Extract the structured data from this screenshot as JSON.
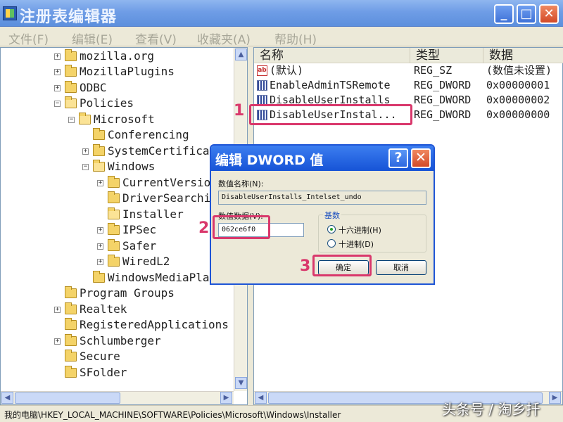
{
  "window": {
    "title": "注册表编辑器",
    "minimize": "_",
    "maximize": "□",
    "close": "✕"
  },
  "menu": [
    "文件(F)",
    "编辑(E)",
    "查看(V)",
    "收藏夹(A)",
    "帮助(H)"
  ],
  "tree": {
    "items": [
      {
        "label": "mozilla.org",
        "expander": "+"
      },
      {
        "label": "MozillaPlugins",
        "expander": "+"
      },
      {
        "label": "ODBC",
        "expander": "+"
      },
      {
        "label": "Policies",
        "expander": "−"
      },
      {
        "label": "Microsoft",
        "expander": "−"
      },
      {
        "label": "Conferencing",
        "expander": ""
      },
      {
        "label": "SystemCertificates",
        "expander": "+"
      },
      {
        "label": "Windows",
        "expander": "−"
      },
      {
        "label": "CurrentVersion",
        "expander": "+"
      },
      {
        "label": "DriverSearching",
        "expander": ""
      },
      {
        "label": "Installer",
        "expander": ""
      },
      {
        "label": "IPSec",
        "expander": "+"
      },
      {
        "label": "Safer",
        "expander": "+"
      },
      {
        "label": "WiredL2",
        "expander": "+"
      },
      {
        "label": "WindowsMediaPlayer",
        "expander": ""
      },
      {
        "label": "Program Groups",
        "expander": ""
      },
      {
        "label": "Realtek",
        "expander": "+"
      },
      {
        "label": "RegisteredApplications",
        "expander": ""
      },
      {
        "label": "Schlumberger",
        "expander": "+"
      },
      {
        "label": "Secure",
        "expander": ""
      },
      {
        "label": "SFolder",
        "expander": ""
      }
    ]
  },
  "list": {
    "columns": [
      "名称",
      "类型",
      "数据"
    ],
    "rows": [
      {
        "name": "(默认)",
        "type": "REG_SZ",
        "data": "(数值未设置)",
        "icon": "string-value-icon"
      },
      {
        "name": "EnableAdminTSRemote",
        "type": "REG_DWORD",
        "data": "0x00000001",
        "icon": "dword-value-icon"
      },
      {
        "name": "DisableUserInstalls",
        "type": "REG_DWORD",
        "data": "0x00000002",
        "icon": "dword-value-icon"
      },
      {
        "name": "DisableUserInstal...",
        "type": "REG_DWORD",
        "data": "0x00000000",
        "icon": "dword-value-icon"
      }
    ]
  },
  "dialog": {
    "title": "编辑 DWORD 值",
    "help": "?",
    "close": "✕",
    "name_label": "数值名称(N):",
    "name_value": "DisableUserInstalls_Intelset_undo",
    "data_label": "数值数据(V):",
    "data_value": "062ce6f0",
    "base_label": "基数",
    "hex_label": "十六进制(H)",
    "dec_label": "十进制(D)",
    "selected_base": "hex",
    "ok_label": "确定",
    "cancel_label": "取消"
  },
  "annotations": {
    "badge1": "1",
    "badge2": "2",
    "badge3": "3",
    "color": "#d9386c"
  },
  "status": {
    "path": "我的电脑\\HKEY_LOCAL_MACHINE\\SOFTWARE\\Policies\\Microsoft\\Windows\\Installer"
  },
  "watermark": "头条号 / 淘乡扦"
}
